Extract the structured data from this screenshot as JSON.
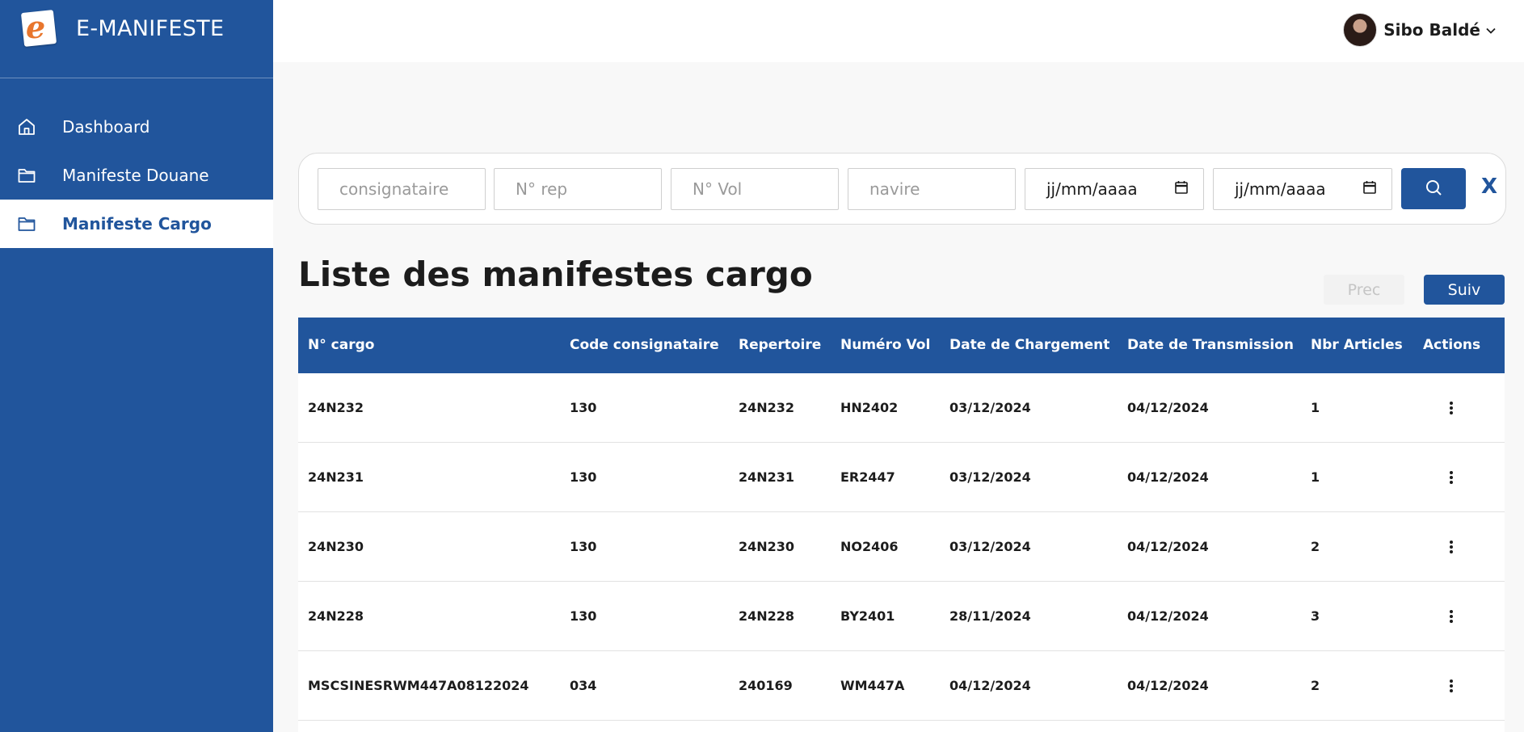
{
  "app": {
    "title": "E-MANIFESTE"
  },
  "colors": {
    "primary": "#21559c",
    "logo_accent": "#e8762d"
  },
  "sidebar": {
    "items": [
      {
        "label": "Dashboard",
        "icon": "home-icon",
        "active": false
      },
      {
        "label": "Manifeste Douane",
        "icon": "folder-icon",
        "active": false
      },
      {
        "label": "Manifeste Cargo",
        "icon": "folder-icon",
        "active": true
      }
    ]
  },
  "user": {
    "name": "Sibo Baldé"
  },
  "filters": {
    "consignataire_placeholder": "consignataire",
    "rep_placeholder": "N° rep",
    "vol_placeholder": "N° Vol",
    "navire_placeholder": "navire",
    "date_from": "jj/mm/aaaa",
    "date_to": "jj/mm/aaaa",
    "clear_label": "X"
  },
  "list": {
    "title": "Liste des manifestes cargo",
    "prev_label": "Prec",
    "next_label": "Suiv",
    "columns": [
      "N° cargo",
      "Code consignataire",
      "Repertoire",
      "Numéro Vol",
      "Date de Chargement",
      "Date de Transmission",
      "Nbr Articles",
      "Actions"
    ],
    "rows": [
      [
        "24N232",
        "130",
        "24N232",
        "HN2402",
        "03/12/2024",
        "04/12/2024",
        "1"
      ],
      [
        "24N231",
        "130",
        "24N231",
        "ER2447",
        "03/12/2024",
        "04/12/2024",
        "1"
      ],
      [
        "24N230",
        "130",
        "24N230",
        "NO2406",
        "03/12/2024",
        "04/12/2024",
        "2"
      ],
      [
        "24N228",
        "130",
        "24N228",
        "BY2401",
        "28/11/2024",
        "04/12/2024",
        "3"
      ],
      [
        "MSCSINESRWM447A08122024",
        "034",
        "240169",
        "WM447A",
        "04/12/2024",
        "04/12/2024",
        "2"
      ]
    ]
  }
}
